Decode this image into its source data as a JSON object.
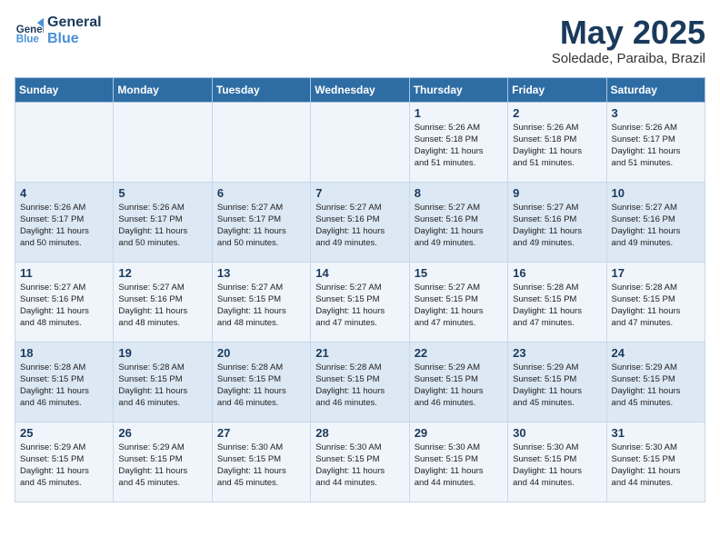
{
  "header": {
    "logo_line1": "General",
    "logo_line2": "Blue",
    "month": "May 2025",
    "location": "Soledade, Paraiba, Brazil"
  },
  "weekdays": [
    "Sunday",
    "Monday",
    "Tuesday",
    "Wednesday",
    "Thursday",
    "Friday",
    "Saturday"
  ],
  "weeks": [
    [
      {
        "day": "",
        "info": ""
      },
      {
        "day": "",
        "info": ""
      },
      {
        "day": "",
        "info": ""
      },
      {
        "day": "",
        "info": ""
      },
      {
        "day": "1",
        "info": "Sunrise: 5:26 AM\nSunset: 5:18 PM\nDaylight: 11 hours\nand 51 minutes."
      },
      {
        "day": "2",
        "info": "Sunrise: 5:26 AM\nSunset: 5:18 PM\nDaylight: 11 hours\nand 51 minutes."
      },
      {
        "day": "3",
        "info": "Sunrise: 5:26 AM\nSunset: 5:17 PM\nDaylight: 11 hours\nand 51 minutes."
      }
    ],
    [
      {
        "day": "4",
        "info": "Sunrise: 5:26 AM\nSunset: 5:17 PM\nDaylight: 11 hours\nand 50 minutes."
      },
      {
        "day": "5",
        "info": "Sunrise: 5:26 AM\nSunset: 5:17 PM\nDaylight: 11 hours\nand 50 minutes."
      },
      {
        "day": "6",
        "info": "Sunrise: 5:27 AM\nSunset: 5:17 PM\nDaylight: 11 hours\nand 50 minutes."
      },
      {
        "day": "7",
        "info": "Sunrise: 5:27 AM\nSunset: 5:16 PM\nDaylight: 11 hours\nand 49 minutes."
      },
      {
        "day": "8",
        "info": "Sunrise: 5:27 AM\nSunset: 5:16 PM\nDaylight: 11 hours\nand 49 minutes."
      },
      {
        "day": "9",
        "info": "Sunrise: 5:27 AM\nSunset: 5:16 PM\nDaylight: 11 hours\nand 49 minutes."
      },
      {
        "day": "10",
        "info": "Sunrise: 5:27 AM\nSunset: 5:16 PM\nDaylight: 11 hours\nand 49 minutes."
      }
    ],
    [
      {
        "day": "11",
        "info": "Sunrise: 5:27 AM\nSunset: 5:16 PM\nDaylight: 11 hours\nand 48 minutes."
      },
      {
        "day": "12",
        "info": "Sunrise: 5:27 AM\nSunset: 5:16 PM\nDaylight: 11 hours\nand 48 minutes."
      },
      {
        "day": "13",
        "info": "Sunrise: 5:27 AM\nSunset: 5:15 PM\nDaylight: 11 hours\nand 48 minutes."
      },
      {
        "day": "14",
        "info": "Sunrise: 5:27 AM\nSunset: 5:15 PM\nDaylight: 11 hours\nand 47 minutes."
      },
      {
        "day": "15",
        "info": "Sunrise: 5:27 AM\nSunset: 5:15 PM\nDaylight: 11 hours\nand 47 minutes."
      },
      {
        "day": "16",
        "info": "Sunrise: 5:28 AM\nSunset: 5:15 PM\nDaylight: 11 hours\nand 47 minutes."
      },
      {
        "day": "17",
        "info": "Sunrise: 5:28 AM\nSunset: 5:15 PM\nDaylight: 11 hours\nand 47 minutes."
      }
    ],
    [
      {
        "day": "18",
        "info": "Sunrise: 5:28 AM\nSunset: 5:15 PM\nDaylight: 11 hours\nand 46 minutes."
      },
      {
        "day": "19",
        "info": "Sunrise: 5:28 AM\nSunset: 5:15 PM\nDaylight: 11 hours\nand 46 minutes."
      },
      {
        "day": "20",
        "info": "Sunrise: 5:28 AM\nSunset: 5:15 PM\nDaylight: 11 hours\nand 46 minutes."
      },
      {
        "day": "21",
        "info": "Sunrise: 5:28 AM\nSunset: 5:15 PM\nDaylight: 11 hours\nand 46 minutes."
      },
      {
        "day": "22",
        "info": "Sunrise: 5:29 AM\nSunset: 5:15 PM\nDaylight: 11 hours\nand 46 minutes."
      },
      {
        "day": "23",
        "info": "Sunrise: 5:29 AM\nSunset: 5:15 PM\nDaylight: 11 hours\nand 45 minutes."
      },
      {
        "day": "24",
        "info": "Sunrise: 5:29 AM\nSunset: 5:15 PM\nDaylight: 11 hours\nand 45 minutes."
      }
    ],
    [
      {
        "day": "25",
        "info": "Sunrise: 5:29 AM\nSunset: 5:15 PM\nDaylight: 11 hours\nand 45 minutes."
      },
      {
        "day": "26",
        "info": "Sunrise: 5:29 AM\nSunset: 5:15 PM\nDaylight: 11 hours\nand 45 minutes."
      },
      {
        "day": "27",
        "info": "Sunrise: 5:30 AM\nSunset: 5:15 PM\nDaylight: 11 hours\nand 45 minutes."
      },
      {
        "day": "28",
        "info": "Sunrise: 5:30 AM\nSunset: 5:15 PM\nDaylight: 11 hours\nand 44 minutes."
      },
      {
        "day": "29",
        "info": "Sunrise: 5:30 AM\nSunset: 5:15 PM\nDaylight: 11 hours\nand 44 minutes."
      },
      {
        "day": "30",
        "info": "Sunrise: 5:30 AM\nSunset: 5:15 PM\nDaylight: 11 hours\nand 44 minutes."
      },
      {
        "day": "31",
        "info": "Sunrise: 5:30 AM\nSunset: 5:15 PM\nDaylight: 11 hours\nand 44 minutes."
      }
    ]
  ]
}
